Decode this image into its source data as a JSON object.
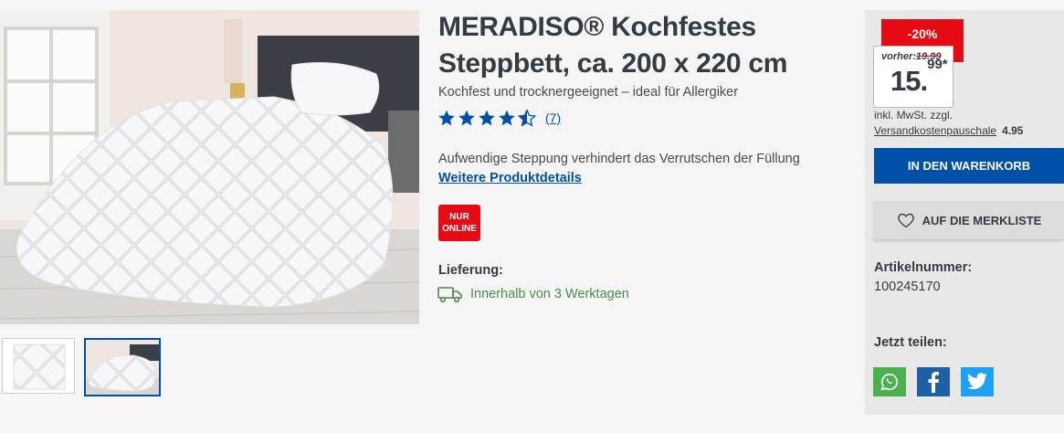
{
  "product": {
    "title": "MERADISO® Kochfestes Steppbett, ca. 200 x 220 cm",
    "subtitle": "Kochfest und trocknergeeignet – ideal für Allergiker",
    "rating_stars": 4.5,
    "rating_count": "(7)",
    "feature": "Aufwendige Steppung verhindert das Verrutschen der Füllung",
    "details_link": "Weitere Produktdetails",
    "badge_line1": "NUR",
    "badge_line2": "ONLINE",
    "delivery_label": "Lieferung:",
    "delivery_text": "Innerhalb von 3 Werktagen"
  },
  "gallery": {
    "active_thumb": 2,
    "thumbs": [
      "quilt-thumb",
      "bedroom-thumb"
    ]
  },
  "buybox": {
    "discount": "-20%",
    "old_price_label": "vorher:",
    "old_price": "19.99",
    "price_main": "15.",
    "price_cents": "99*",
    "vat": "inkl. MwSt. zzgl.",
    "shipping_link": "Versandkostenpauschale",
    "shipping_amount": "4.95",
    "cart_button": "IN DEN WARENKORB",
    "wishlist_button": "AUF DIE MERKLISTE",
    "article_label": "Artikelnummer:",
    "article_number": "100245170",
    "share_label": "Jetzt teilen:"
  },
  "colors": {
    "brand_blue": "#0050aa",
    "sale_red": "#e60a14",
    "delivery_green": "#4d8a4d",
    "whatsapp": "#4caf50",
    "facebook": "#1e5fa8",
    "twitter": "#1da1f2"
  },
  "icons": [
    "star-icon",
    "star-half-icon",
    "truck-icon",
    "heart-icon",
    "whatsapp-icon",
    "facebook-icon",
    "twitter-icon"
  ]
}
